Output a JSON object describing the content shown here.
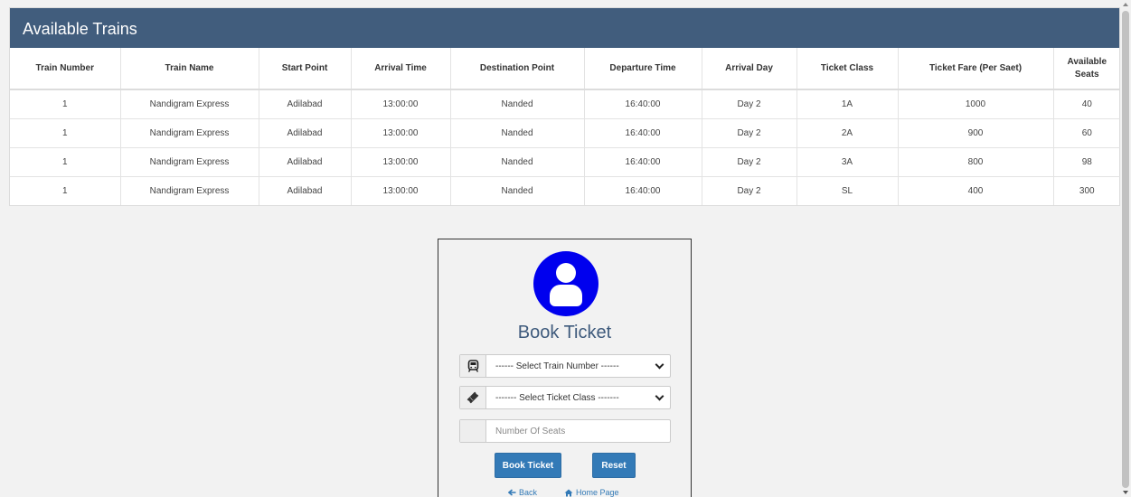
{
  "panel": {
    "title": "Available Trains"
  },
  "table": {
    "headers": [
      "Train Number",
      "Train Name",
      "Start Point",
      "Arrival Time",
      "Destination Point",
      "Departure Time",
      "Arrival Day",
      "Ticket Class",
      "Ticket Fare (Per Saet)",
      "Available Seats"
    ],
    "rows": [
      [
        "1",
        "Nandigram Express",
        "Adilabad",
        "13:00:00",
        "Nanded",
        "16:40:00",
        "Day 2",
        "1A",
        "1000",
        "40"
      ],
      [
        "1",
        "Nandigram Express",
        "Adilabad",
        "13:00:00",
        "Nanded",
        "16:40:00",
        "Day 2",
        "2A",
        "900",
        "60"
      ],
      [
        "1",
        "Nandigram Express",
        "Adilabad",
        "13:00:00",
        "Nanded",
        "16:40:00",
        "Day 2",
        "3A",
        "800",
        "98"
      ],
      [
        "1",
        "Nandigram Express",
        "Adilabad",
        "13:00:00",
        "Nanded",
        "16:40:00",
        "Day 2",
        "SL",
        "400",
        "300"
      ]
    ]
  },
  "form": {
    "title": "Book Ticket",
    "train_select": "------ Select Train Number ------",
    "class_select": "------- Select Ticket Class -------",
    "seats_placeholder": "Number Of Seats",
    "book_label": "Book Ticket",
    "reset_label": "Reset",
    "back_label": "Back",
    "home_label": "Home Page"
  },
  "icons": {
    "avatar": "user-icon",
    "train": "train-icon",
    "ticket": "ticket-icon",
    "back": "arrow-left-icon",
    "home": "home-icon"
  },
  "colors": {
    "header": "#415d7d",
    "avatar": "#0000ee",
    "button": "#337ab7",
    "title": "#3e5a7c"
  }
}
